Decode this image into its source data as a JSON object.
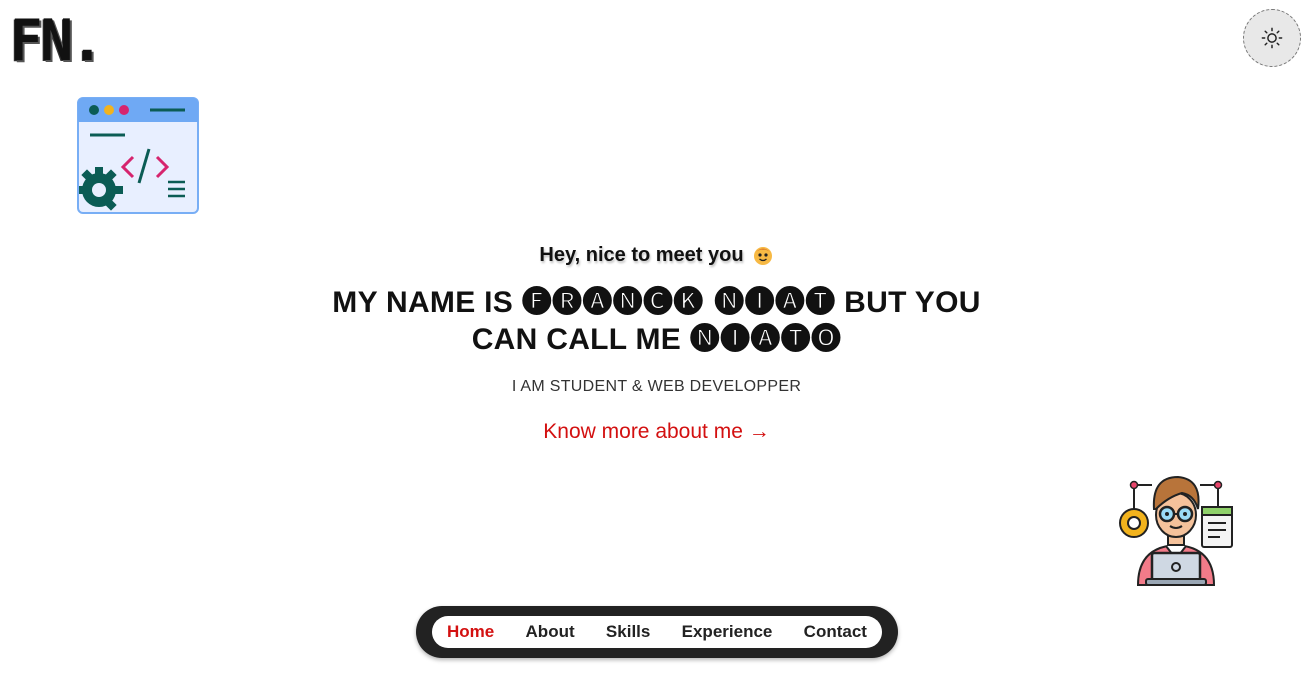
{
  "brand": {
    "logo_text": "FN."
  },
  "theme_toggle": {
    "icon": "sun-icon"
  },
  "hero": {
    "greeting": "Hey, nice to meet you",
    "greeting_emoji": "smiling-face-emoji",
    "headline_prefix": "MY NAME IS",
    "headline_name": "🅕🅡🅐🅝🅒🅚 🅝🅘🅐🅣",
    "headline_middle": "BUT YOU CAN CALL ME",
    "headline_nickname": "🅝🅘🅐🅣🅞",
    "subtitle": "I AM STUDENT & WEB DEVELOPPER",
    "cta_label": "Know more about me →"
  },
  "nav": {
    "items": [
      {
        "label": "Home",
        "active": true
      },
      {
        "label": "About",
        "active": false
      },
      {
        "label": "Skills",
        "active": false
      },
      {
        "label": "Experience",
        "active": false
      },
      {
        "label": "Contact",
        "active": false
      }
    ]
  },
  "colors": {
    "accent": "#d31010",
    "nav_bg": "#222222",
    "toggle_bg": "#e8e8e8"
  }
}
